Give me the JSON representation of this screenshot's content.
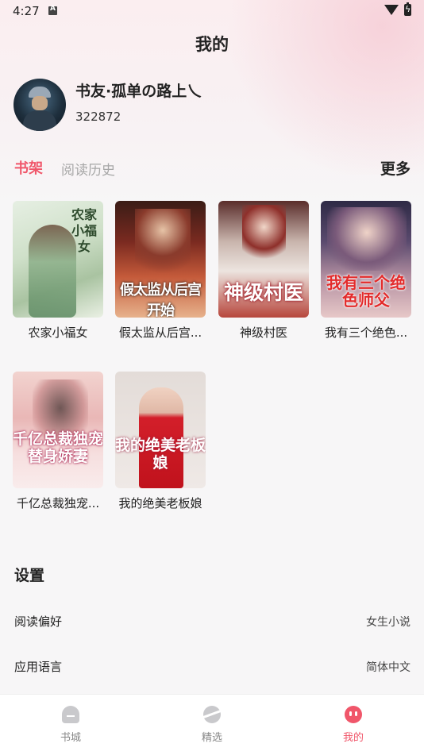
{
  "status_bar": {
    "time": "4:27"
  },
  "header": {
    "title": "我的"
  },
  "profile": {
    "username": "书友·孤单の路上乀",
    "user_id": "322872"
  },
  "shelf_tabs": {
    "active": "书架",
    "history": "阅读历史",
    "more": "更多"
  },
  "books": [
    {
      "title": "农家小福女",
      "cover_text": "农家小福女"
    },
    {
      "title": "假太监从后宫...",
      "cover_text": "假太监从后宫开始"
    },
    {
      "title": "神级村医",
      "cover_text": "神级村医"
    },
    {
      "title": "我有三个绝色...",
      "cover_text": "我有三个绝色师父"
    },
    {
      "title": "千亿总裁独宠...",
      "cover_text": "千亿总裁独宠替身娇妻"
    },
    {
      "title": "我的绝美老板娘",
      "cover_text": "我的绝美老板娘"
    }
  ],
  "settings": {
    "title": "设置",
    "rows": [
      {
        "label": "阅读偏好",
        "value": "女生小说"
      },
      {
        "label": "应用语言",
        "value": "简体中文"
      }
    ]
  },
  "tabbar": {
    "items": [
      {
        "label": "书城",
        "icon": "bookstore-icon"
      },
      {
        "label": "精选",
        "icon": "planet-icon"
      },
      {
        "label": "我的",
        "icon": "mine-icon"
      }
    ],
    "active_color": "#f0566a"
  },
  "colors": {
    "accent": "#f0566a",
    "inactive": "#a7a7a7"
  }
}
